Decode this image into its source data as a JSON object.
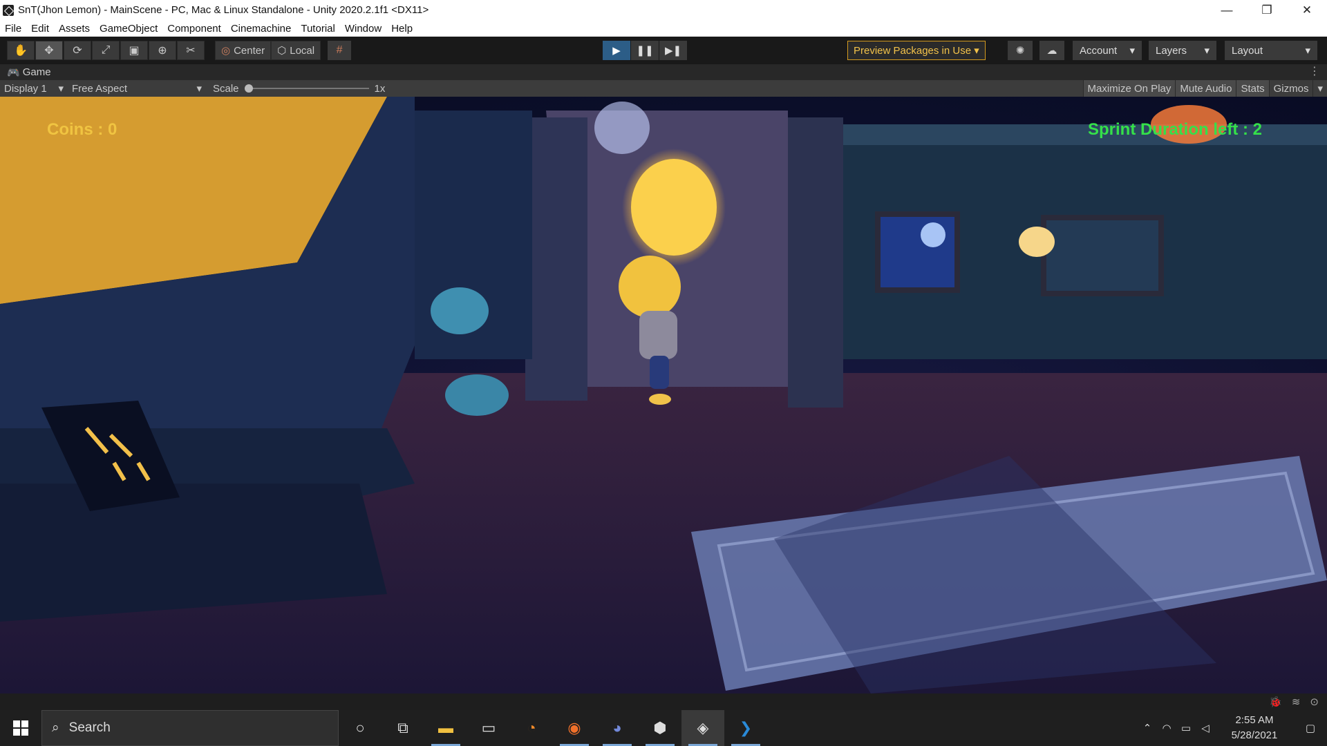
{
  "window": {
    "title": "SnT(Jhon Lemon) - MainScene - PC, Mac & Linux Standalone - Unity 2020.2.1f1 <DX11>",
    "minimize": "—",
    "restore": "❐",
    "close": "✕"
  },
  "menu": [
    "File",
    "Edit",
    "Assets",
    "GameObject",
    "Component",
    "Cinemachine",
    "Tutorial",
    "Window",
    "Help"
  ],
  "toolbar": {
    "tools": [
      {
        "name": "hand-tool-icon",
        "glyph": "✋"
      },
      {
        "name": "move-tool-icon",
        "glyph": "✥"
      },
      {
        "name": "rotate-tool-icon",
        "glyph": "⟳"
      },
      {
        "name": "scale-tool-icon",
        "glyph": "⤢"
      },
      {
        "name": "rect-tool-icon",
        "glyph": "▣"
      },
      {
        "name": "transform-tool-icon",
        "glyph": "⊕"
      },
      {
        "name": "custom-tool-icon",
        "glyph": "✂"
      }
    ],
    "pivot_center": "Center",
    "pivot_local": "Local",
    "play_glyph": "▶",
    "pause_glyph": "❚❚",
    "step_glyph": "▶❚",
    "preview_packages": "Preview Packages in Use ▾",
    "account": "Account",
    "layers": "Layers",
    "layout": "Layout"
  },
  "tab": {
    "game_label": "Game"
  },
  "gamebar": {
    "display": "Display 1",
    "aspect": "Free Aspect",
    "scale_label": "Scale",
    "scale_value": "1x",
    "maximize_on_play": "Maximize On Play",
    "mute_audio": "Mute Audio",
    "stats": "Stats",
    "gizmos": "Gizmos"
  },
  "hud": {
    "coins": "Coins : 0",
    "sprint": "Sprint Duration left : 2"
  },
  "taskbar": {
    "search_placeholder": "Search",
    "time": "2:55 AM",
    "date": "5/28/2021"
  }
}
